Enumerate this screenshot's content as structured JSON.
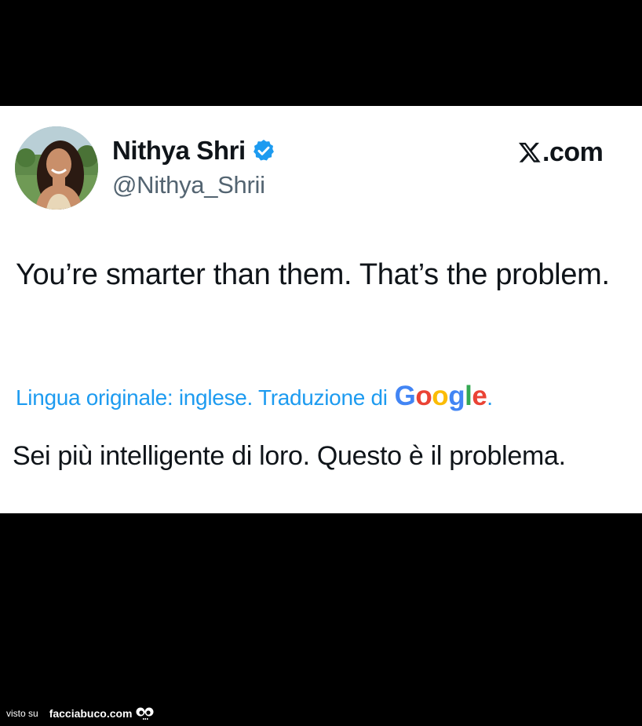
{
  "tweet": {
    "author_name": "Nithya Shri",
    "author_handle": "@Nithya_Shrii",
    "verified": true,
    "brand_logo": "x-logo-icon",
    "brand_suffix": ".com",
    "text": "You’re smarter than them. That’s the problem.",
    "translation_notice": "Lingua originale: inglese. Traduzione di",
    "translation_provider": [
      "G",
      "o",
      "o",
      "g",
      "l",
      "e"
    ],
    "translation_punct": ".",
    "translated_text": "Sei più intelligente di loro. Questo è il problema."
  },
  "watermark": {
    "prefix": "visto su",
    "site": "facciabuco.com",
    "icon": "eyes-icon"
  },
  "colors": {
    "background": "#000000",
    "card": "#ffffff",
    "text": "#0f1419",
    "secondary": "#536471",
    "link": "#1d9bf0",
    "verified": "#1d9bf0"
  }
}
